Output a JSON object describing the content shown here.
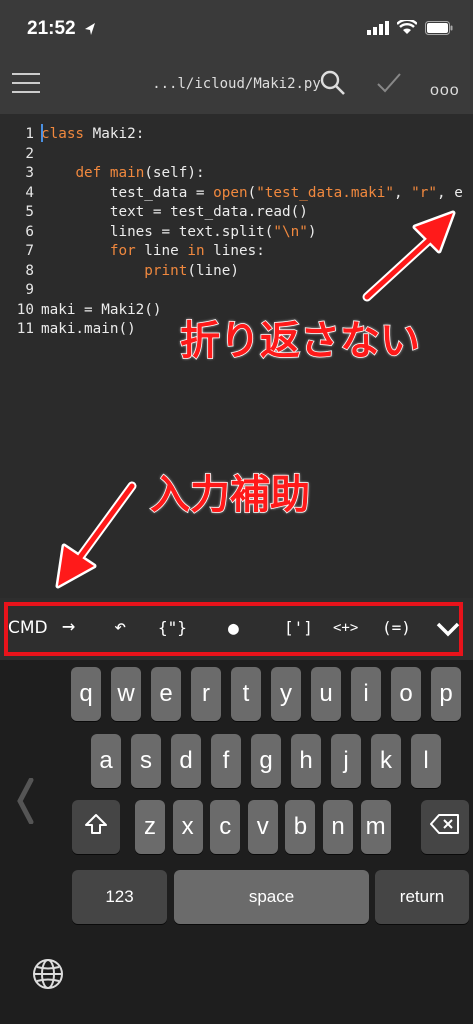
{
  "status": {
    "time": "21:52"
  },
  "nav": {
    "title": "...l/icloud/Maki2.py",
    "more": "ooo"
  },
  "code": {
    "lines": [
      {
        "n": "1",
        "parts": [
          [
            "kw",
            "class"
          ],
          [
            "fn",
            " Maki2:"
          ]
        ]
      },
      {
        "n": "2",
        "parts": []
      },
      {
        "n": "3",
        "parts": [
          [
            "fn",
            "    "
          ],
          [
            "kw",
            "def"
          ],
          [
            "fn",
            " "
          ],
          [
            "bi",
            "main"
          ],
          [
            "fn",
            "(self):"
          ]
        ]
      },
      {
        "n": "4",
        "parts": [
          [
            "fn",
            "        test_data = "
          ],
          [
            "bi",
            "open"
          ],
          [
            "fn",
            "("
          ],
          [
            "str",
            "\"test_data.maki\""
          ],
          [
            "fn",
            ", "
          ],
          [
            "str",
            "\"r\""
          ],
          [
            "fn",
            ", e"
          ]
        ]
      },
      {
        "n": "5",
        "parts": [
          [
            "fn",
            "        text = test_data.read()"
          ]
        ]
      },
      {
        "n": "6",
        "parts": [
          [
            "fn",
            "        lines = text.split("
          ],
          [
            "str",
            "\"\\n\""
          ],
          [
            "fn",
            ")"
          ]
        ]
      },
      {
        "n": "7",
        "parts": [
          [
            "fn",
            "        "
          ],
          [
            "kw",
            "for"
          ],
          [
            "fn",
            " line "
          ],
          [
            "kw",
            "in"
          ],
          [
            "fn",
            " lines:"
          ]
        ]
      },
      {
        "n": "8",
        "parts": [
          [
            "fn",
            "            "
          ],
          [
            "bi",
            "print"
          ],
          [
            "fn",
            "(line)"
          ]
        ]
      },
      {
        "n": "9",
        "parts": []
      },
      {
        "n": "10",
        "parts": [
          [
            "fn",
            "maki = Maki2()"
          ]
        ]
      },
      {
        "n": "11",
        "parts": [
          [
            "fn",
            "maki.main()"
          ]
        ]
      }
    ]
  },
  "annotations": {
    "nowrap": "折り返さない",
    "input_assist": "入力補助"
  },
  "toolbar": {
    "cmd": "CMD",
    "arrow": "→",
    "undo": "↶",
    "braces": "{\"}",
    "dot": "●",
    "brackets": "[']",
    "angle": "<+>",
    "paren": "(=)"
  },
  "keyboard": {
    "row1": [
      "q",
      "w",
      "e",
      "r",
      "t",
      "y",
      "u",
      "i",
      "o",
      "p"
    ],
    "row2": [
      "a",
      "s",
      "d",
      "f",
      "g",
      "h",
      "j",
      "k",
      "l"
    ],
    "row3": [
      "z",
      "x",
      "c",
      "v",
      "b",
      "n",
      "m"
    ],
    "num": "123",
    "space": "space",
    "return": "return"
  },
  "colors": {
    "accent_red": "#e8131b",
    "keyword": "#f0883e"
  }
}
